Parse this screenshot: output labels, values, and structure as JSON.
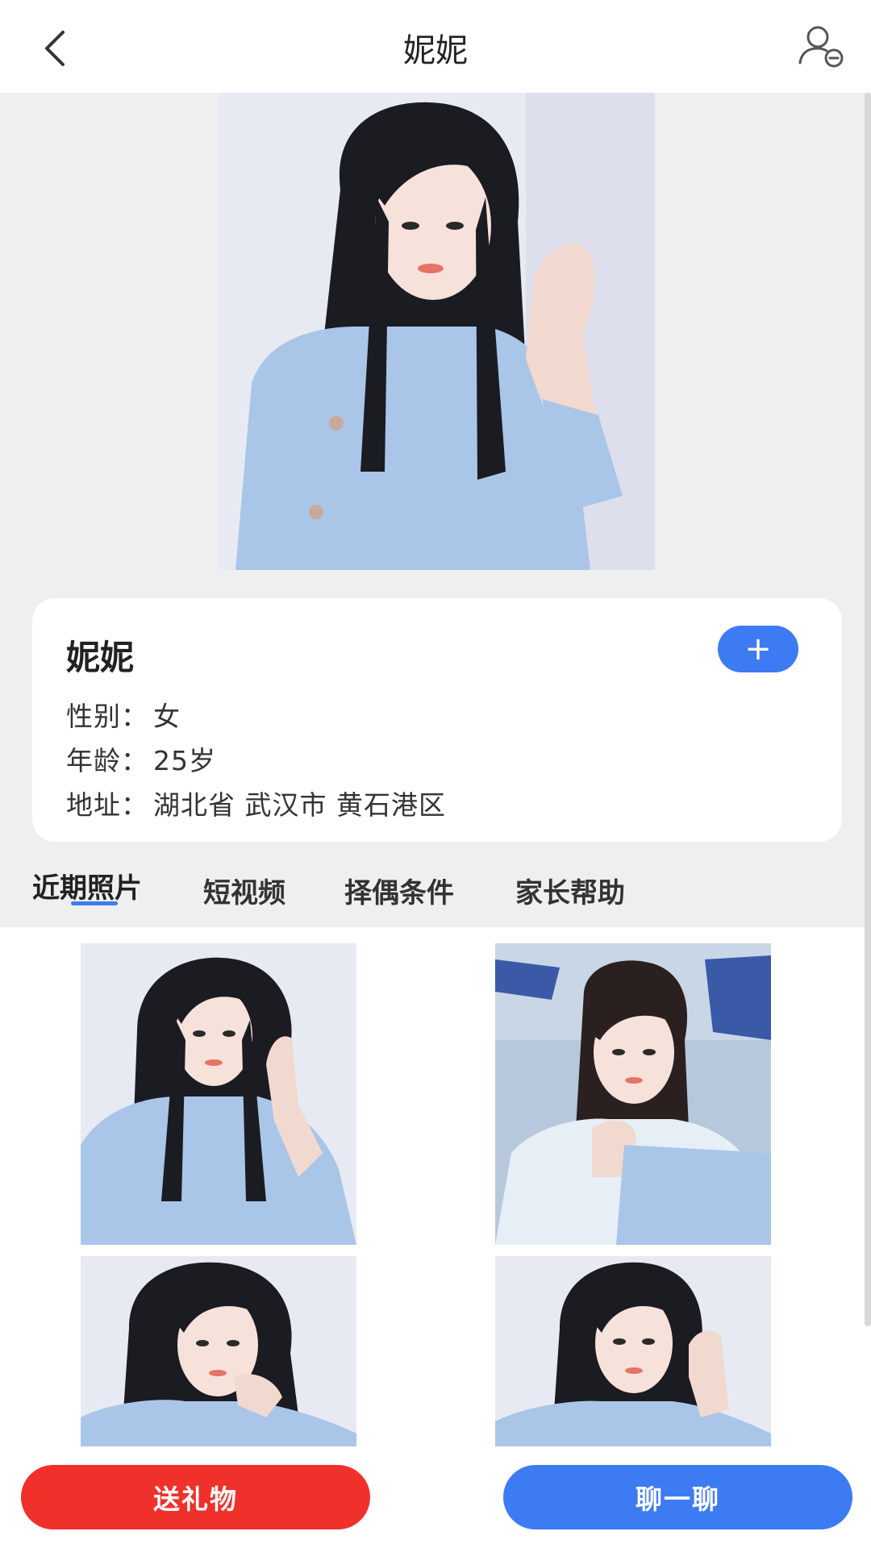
{
  "header": {
    "title": "妮妮",
    "back_icon": "chevron-left-icon",
    "action_icon": "user-remove-icon"
  },
  "profile": {
    "name": "妮妮",
    "add_label": "+",
    "gender_label": "性别：",
    "gender": "女",
    "age_label": "年龄：",
    "age": "25岁",
    "address_label": "地址：",
    "address": "湖北省 武汉市 黄石港区"
  },
  "tabs": [
    {
      "label": "近期照片",
      "active": true
    },
    {
      "label": "短视频",
      "active": false
    },
    {
      "label": "择偶条件",
      "active": false
    },
    {
      "label": "家长帮助",
      "active": false
    }
  ],
  "actions": {
    "gift_label": "送礼物",
    "chat_label": "聊一聊"
  },
  "colors": {
    "accent_blue": "#3d7bf2",
    "gift_red": "#f0302a",
    "sweater_blue": "#a9c6e8"
  }
}
